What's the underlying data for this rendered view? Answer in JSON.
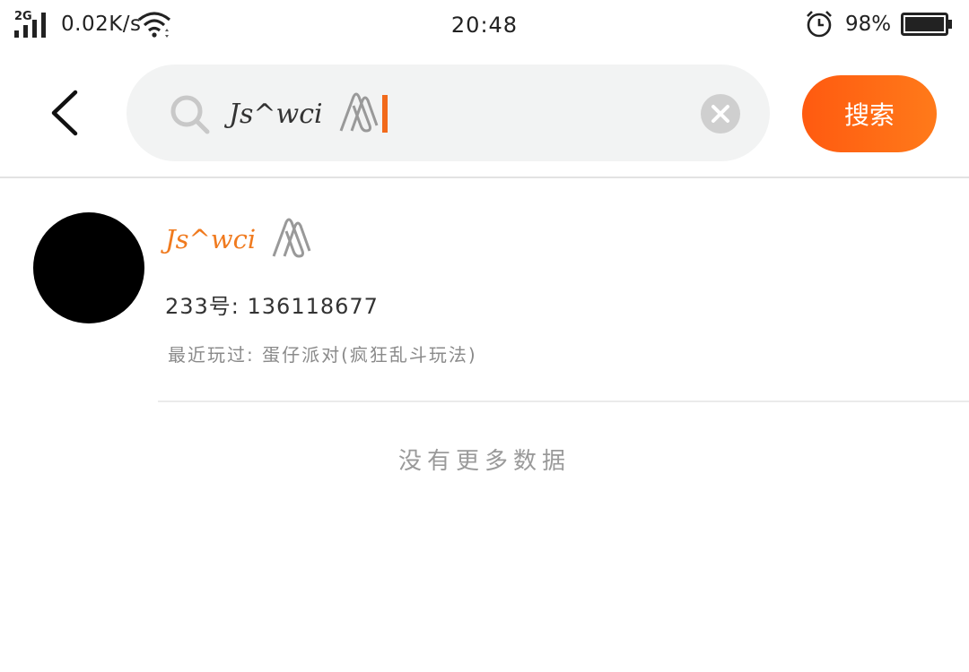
{
  "status_bar": {
    "network_type": "2G",
    "net_speed": "0.02K/s",
    "time": "20:48",
    "battery_percent": "98%"
  },
  "search": {
    "query": "Js^wci",
    "button_label": "搜索"
  },
  "results": [
    {
      "name": "Js^wci",
      "id_line": "233号: 136118677",
      "recent_played": "最近玩过: 蛋仔派对(疯狂乱斗玩法)"
    }
  ],
  "footer_text": "没有更多数据",
  "colors": {
    "accent": "#ff6a15",
    "name_color": "#f07a1e",
    "search_bg": "#f2f3f3"
  },
  "icons": [
    "signal-icon",
    "wifi-icon",
    "alarm-icon",
    "battery-icon",
    "back-arrow-icon",
    "search-icon",
    "paperclip-icon",
    "clear-icon"
  ]
}
